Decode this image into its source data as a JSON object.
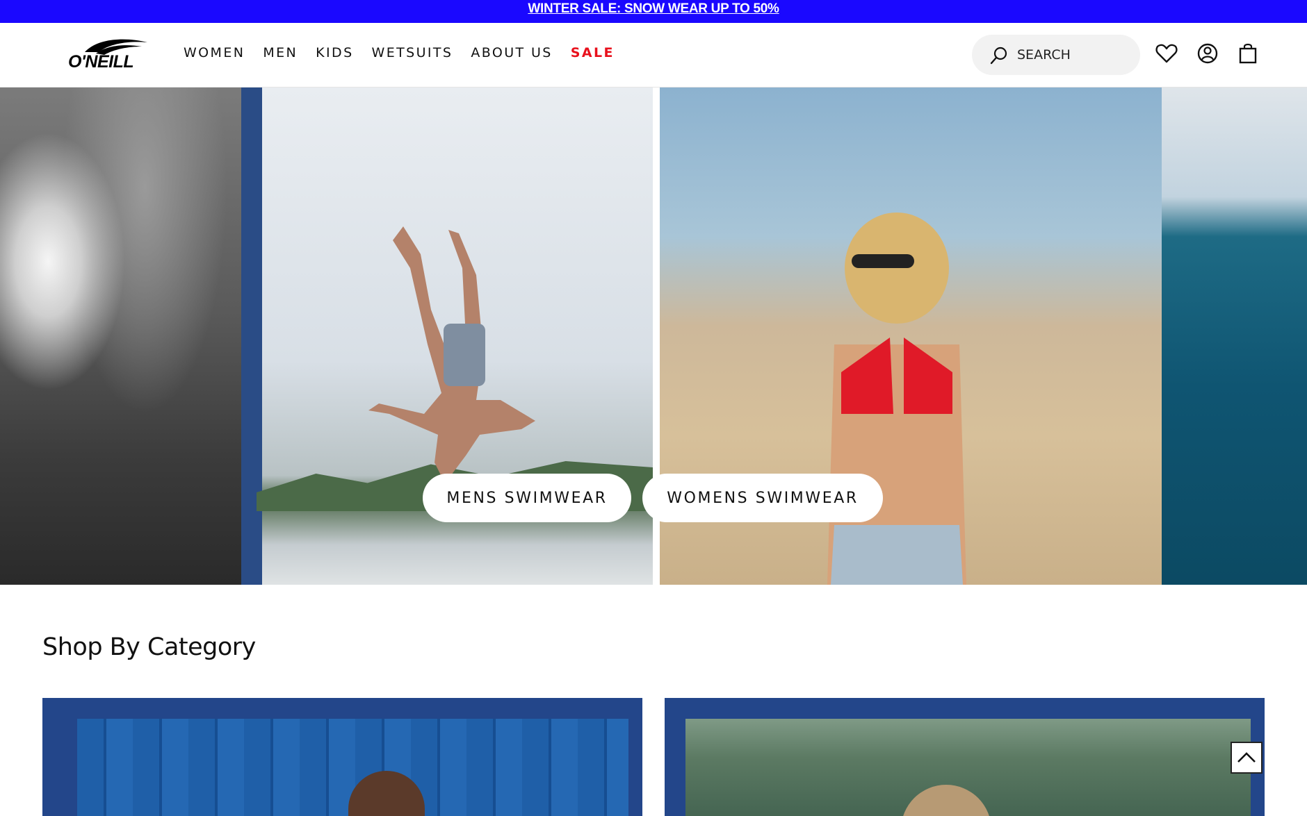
{
  "promo": {
    "text": "WINTER SALE: SNOW WEAR UP TO 50%"
  },
  "brand": {
    "logo_text": "O'NEILL"
  },
  "nav": {
    "items": [
      {
        "label": "WOMEN"
      },
      {
        "label": "MEN"
      },
      {
        "label": "KIDS"
      },
      {
        "label": "WETSUITS"
      },
      {
        "label": "ABOUT US"
      },
      {
        "label": "SALE"
      }
    ]
  },
  "search": {
    "placeholder": "SEARCH"
  },
  "header_icons": [
    "heart-icon",
    "account-icon",
    "bag-icon"
  ],
  "hero": {
    "buttons": {
      "mens": "MENS SWIMWEAR",
      "womens": "WOMENS SWIMWEAR"
    }
  },
  "sections": {
    "shop_by_category": {
      "title": "Shop By Category"
    }
  },
  "colors": {
    "promo_bg": "#1a08ff",
    "sale": "#e8101c",
    "category_frame": "#23468a"
  }
}
